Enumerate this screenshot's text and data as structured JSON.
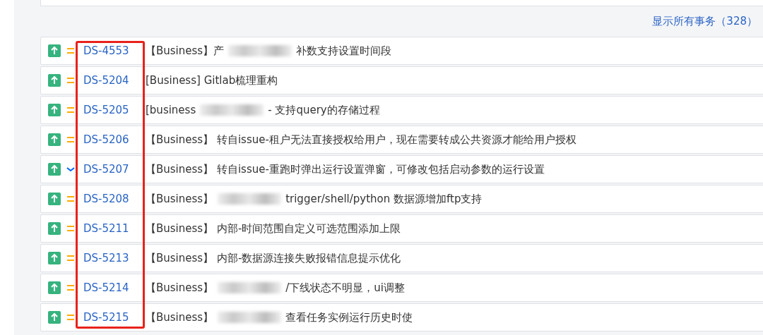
{
  "show_all_link": "显示所有事务（328）",
  "highlight": {
    "kind": "frame"
  },
  "issues": [
    {
      "type_icon": {
        "kind": "improvement"
      },
      "priority_icon": {
        "kind": "medium"
      },
      "key": "DS-4553",
      "prefix": "【Business】产",
      "redacted": true,
      "summary": "补数支持设置时间段"
    },
    {
      "type_icon": {
        "kind": "improvement"
      },
      "priority_icon": {
        "kind": "medium"
      },
      "key": "DS-5204",
      "prefix": "[Business]",
      "redacted": false,
      "summary": "Gitlab梳理重构"
    },
    {
      "type_icon": {
        "kind": "improvement"
      },
      "priority_icon": {
        "kind": "medium"
      },
      "key": "DS-5205",
      "prefix": "[business",
      "redacted": true,
      "summary": "- 支持query的存储过程"
    },
    {
      "type_icon": {
        "kind": "improvement"
      },
      "priority_icon": {
        "kind": "medium"
      },
      "key": "DS-5206",
      "prefix": "【Business】",
      "redacted": false,
      "summary": "转自issue-租户无法直接授权给用户，现在需要转成公共资源才能给用户授权"
    },
    {
      "type_icon": {
        "kind": "improvement"
      },
      "priority_icon": {
        "kind": "low"
      },
      "key": "DS-5207",
      "prefix": "【Business】",
      "redacted": false,
      "summary": "转自issue-重跑时弹出运行设置弹窗，可修改包括启动参数的运行设置"
    },
    {
      "type_icon": {
        "kind": "improvement"
      },
      "priority_icon": {
        "kind": "medium"
      },
      "key": "DS-5208",
      "prefix": "【Business】",
      "redacted": true,
      "summary": "trigger/shell/python 数据源增加ftp支持"
    },
    {
      "type_icon": {
        "kind": "improvement"
      },
      "priority_icon": {
        "kind": "medium"
      },
      "key": "DS-5211",
      "prefix": "【Business】",
      "redacted": false,
      "summary": "内部-时间范围自定义可选范围添加上限"
    },
    {
      "type_icon": {
        "kind": "improvement"
      },
      "priority_icon": {
        "kind": "medium"
      },
      "key": "DS-5213",
      "prefix": "【Business】",
      "redacted": false,
      "summary": "内部-数据源连接失败报错信息提示优化"
    },
    {
      "type_icon": {
        "kind": "improvement"
      },
      "priority_icon": {
        "kind": "medium"
      },
      "key": "DS-5214",
      "prefix": "【Business】",
      "redacted": true,
      "summary": "/下线状态不明显，ui调整"
    },
    {
      "type_icon": {
        "kind": "improvement"
      },
      "priority_icon": {
        "kind": "medium"
      },
      "key": "DS-5215",
      "prefix": "【Business】",
      "redacted": true,
      "summary": "查看任务实例运行历史时使"
    }
  ]
}
